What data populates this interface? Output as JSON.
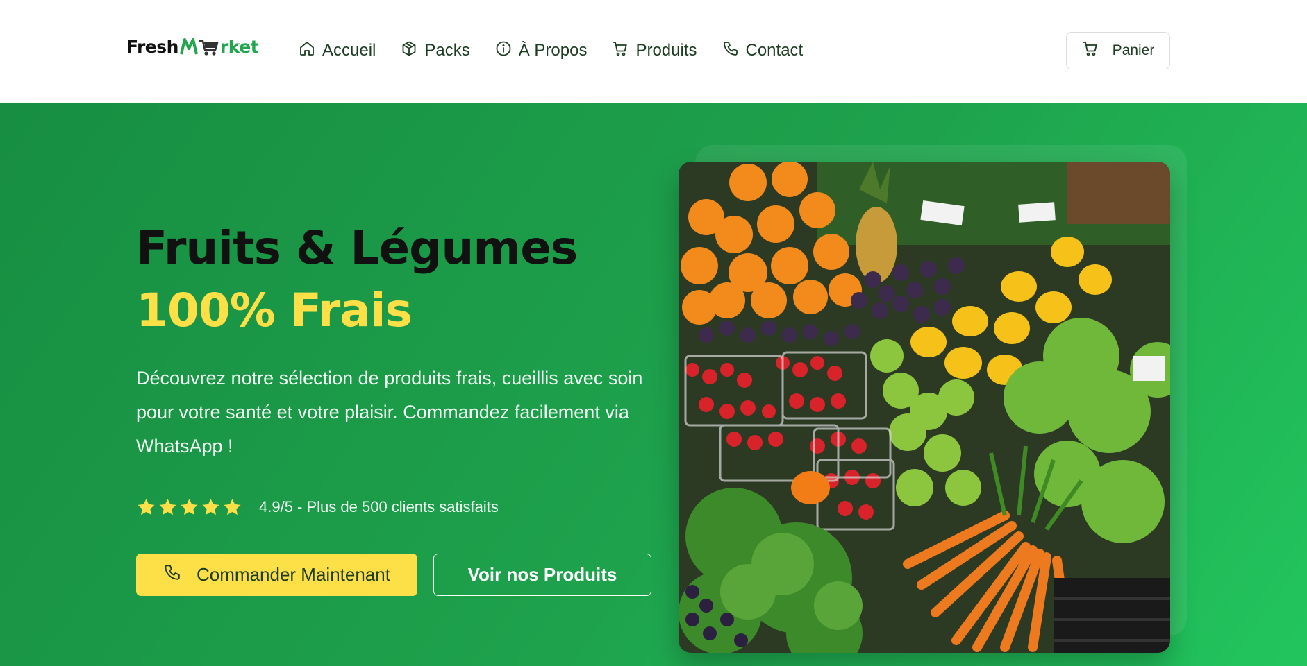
{
  "brand": {
    "part1": "Fresh",
    "part2": "rket"
  },
  "nav": [
    {
      "label": "Accueil",
      "icon": "home-icon"
    },
    {
      "label": "Packs",
      "icon": "package-icon"
    },
    {
      "label": "À Propos",
      "icon": "info-icon"
    },
    {
      "label": "Produits",
      "icon": "cart-icon"
    },
    {
      "label": "Contact",
      "icon": "phone-icon"
    }
  ],
  "cart": {
    "label": "Panier",
    "icon": "cart-icon"
  },
  "hero": {
    "title_line1": "Fruits & Légumes",
    "title_line2": "100% Frais",
    "description": "Découvrez notre sélection de produits frais, cueillis avec soin pour votre santé et votre plaisir. Commandez facilement via WhatsApp !",
    "rating": {
      "stars": 5,
      "text": "4.9/5 - Plus de 500 clients satisfaits"
    },
    "primary_cta": "Commander Maintenant",
    "secondary_cta": "Voir nos Produits"
  },
  "colors": {
    "brand_green": "#22a64d",
    "hero_green": "#1a9a48",
    "accent_yellow": "#fde047",
    "nav_text": "#1c3d21"
  }
}
